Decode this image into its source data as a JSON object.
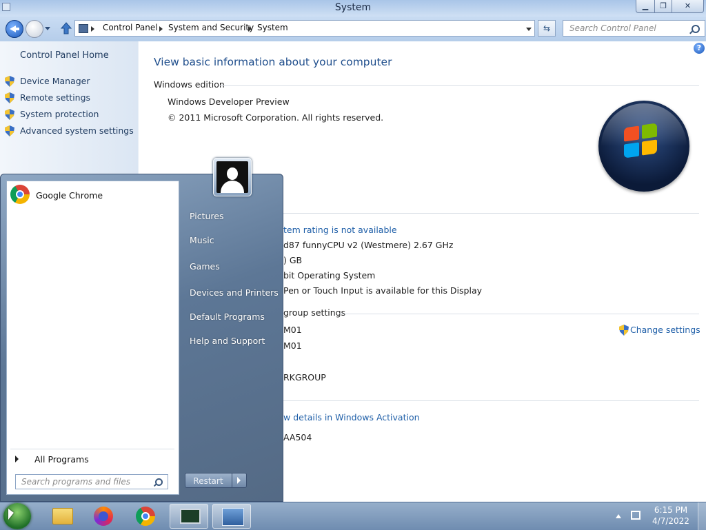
{
  "window": {
    "title": "System"
  },
  "address": {
    "crumbs": [
      "Control Panel",
      "System and Security",
      "System"
    ]
  },
  "search": {
    "placeholder": "Search Control Panel"
  },
  "left_pane": {
    "home": "Control Panel Home",
    "items": [
      "Device Manager",
      "Remote settings",
      "System protection",
      "Advanced system settings"
    ]
  },
  "main": {
    "heading": "View basic information about your computer",
    "edition_section": "Windows edition",
    "edition": "Windows Developer Preview",
    "copyright": "© 2011 Microsoft Corporation. All rights reserved.",
    "rating_link": "tem rating is not available",
    "processor": "d87 funnyCPU v2 (Westmere)   2.67 GHz",
    "memory": ") GB",
    "system_type": "bit Operating System",
    "pen": "Pen or Touch Input is available for this Display",
    "group_section": "group settings",
    "computer_name": "M01",
    "full_name": "M01",
    "workgroup": "RKGROUP",
    "change_settings": "Change settings",
    "activation_link": "w details in Windows Activation",
    "product_id": "AA504"
  },
  "start_menu": {
    "pinned": [
      {
        "label": "Google Chrome",
        "icon": "chrome-icon"
      }
    ],
    "all_programs": "All Programs",
    "search_placeholder": "Search programs and files",
    "right_items": [
      "Pictures",
      "Music",
      "Games",
      "Devices and Printers",
      "Default Programs",
      "Help and Support"
    ],
    "restart": "Restart"
  },
  "taskbar": {
    "apps": [
      "explorer-icon",
      "firefox-icon",
      "chrome-icon",
      "monitor-icon",
      "control-panel-icon"
    ],
    "time": "6:15 PM",
    "date": "4/7/2022"
  }
}
